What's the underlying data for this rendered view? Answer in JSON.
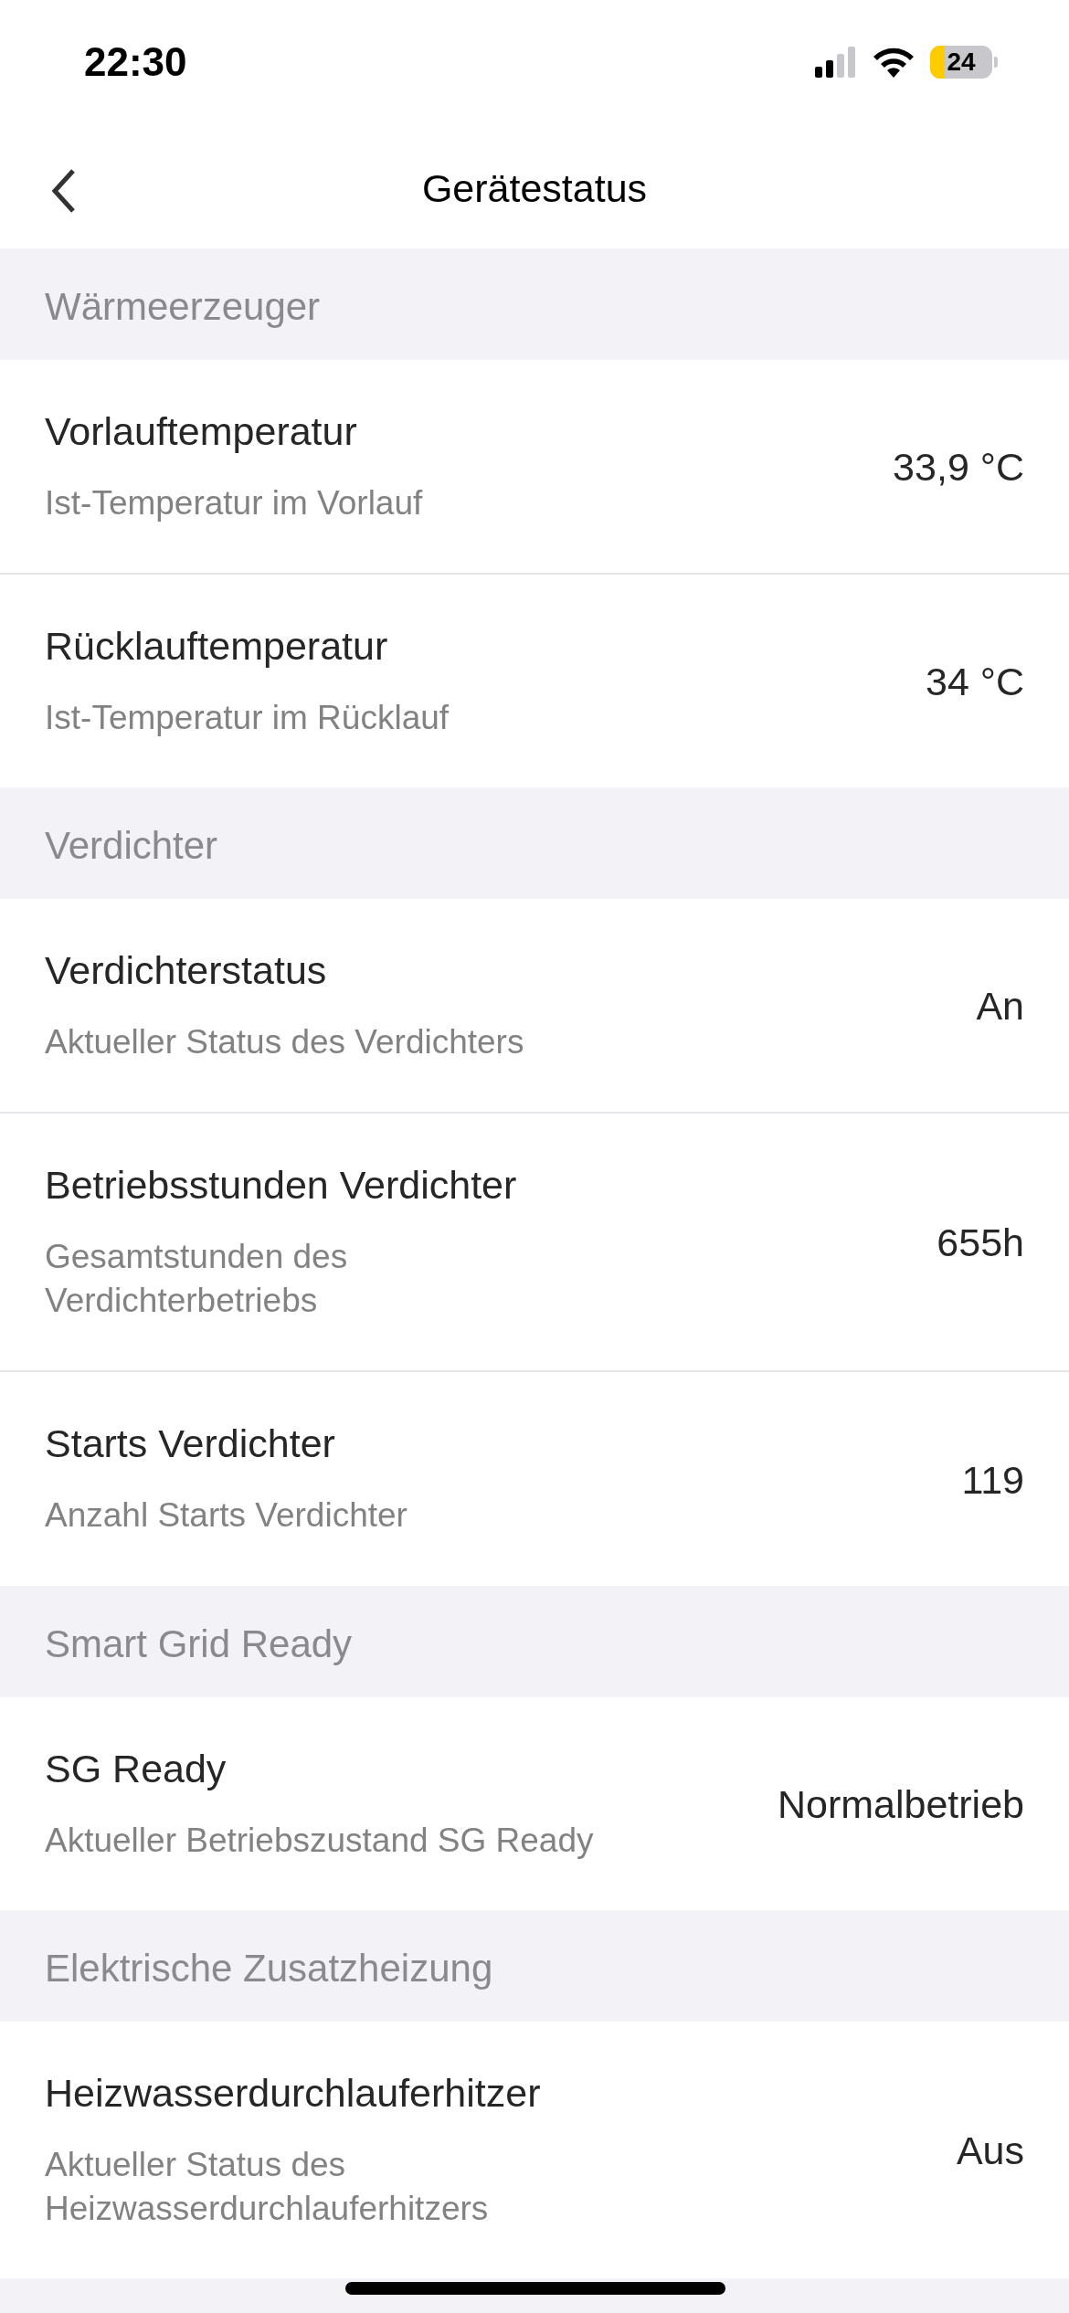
{
  "status_bar": {
    "time": "22:30",
    "battery": "24"
  },
  "nav": {
    "title": "Gerätestatus"
  },
  "sections": [
    {
      "title": "Wärmeerzeuger",
      "rows": [
        {
          "title": "Vorlauftemperatur",
          "subtitle": "Ist-Temperatur im Vorlauf",
          "value": "33,9 °C"
        },
        {
          "title": "Rücklauftemperatur",
          "subtitle": "Ist-Temperatur im Rücklauf",
          "value": "34 °C"
        }
      ]
    },
    {
      "title": "Verdichter",
      "rows": [
        {
          "title": "Verdichterstatus",
          "subtitle": "Aktueller Status des Verdichters",
          "value": "An"
        },
        {
          "title": "Betriebsstunden Verdichter",
          "subtitle": "Gesamtstunden des Verdichterbetriebs",
          "value": "655h"
        },
        {
          "title": "Starts Verdichter",
          "subtitle": "Anzahl Starts Verdichter",
          "value": "119"
        }
      ]
    },
    {
      "title": "Smart Grid Ready",
      "rows": [
        {
          "title": "SG Ready",
          "subtitle": "Aktueller Betriebszustand SG Ready",
          "value": "Normalbetrieb"
        }
      ]
    },
    {
      "title": "Elektrische Zusatzheizung",
      "rows": [
        {
          "title": "Heizwasserdurchlauferhitzer",
          "subtitle": "Aktueller Status des Heizwasserdurchlauferhitzers",
          "value": "Aus"
        }
      ]
    }
  ]
}
